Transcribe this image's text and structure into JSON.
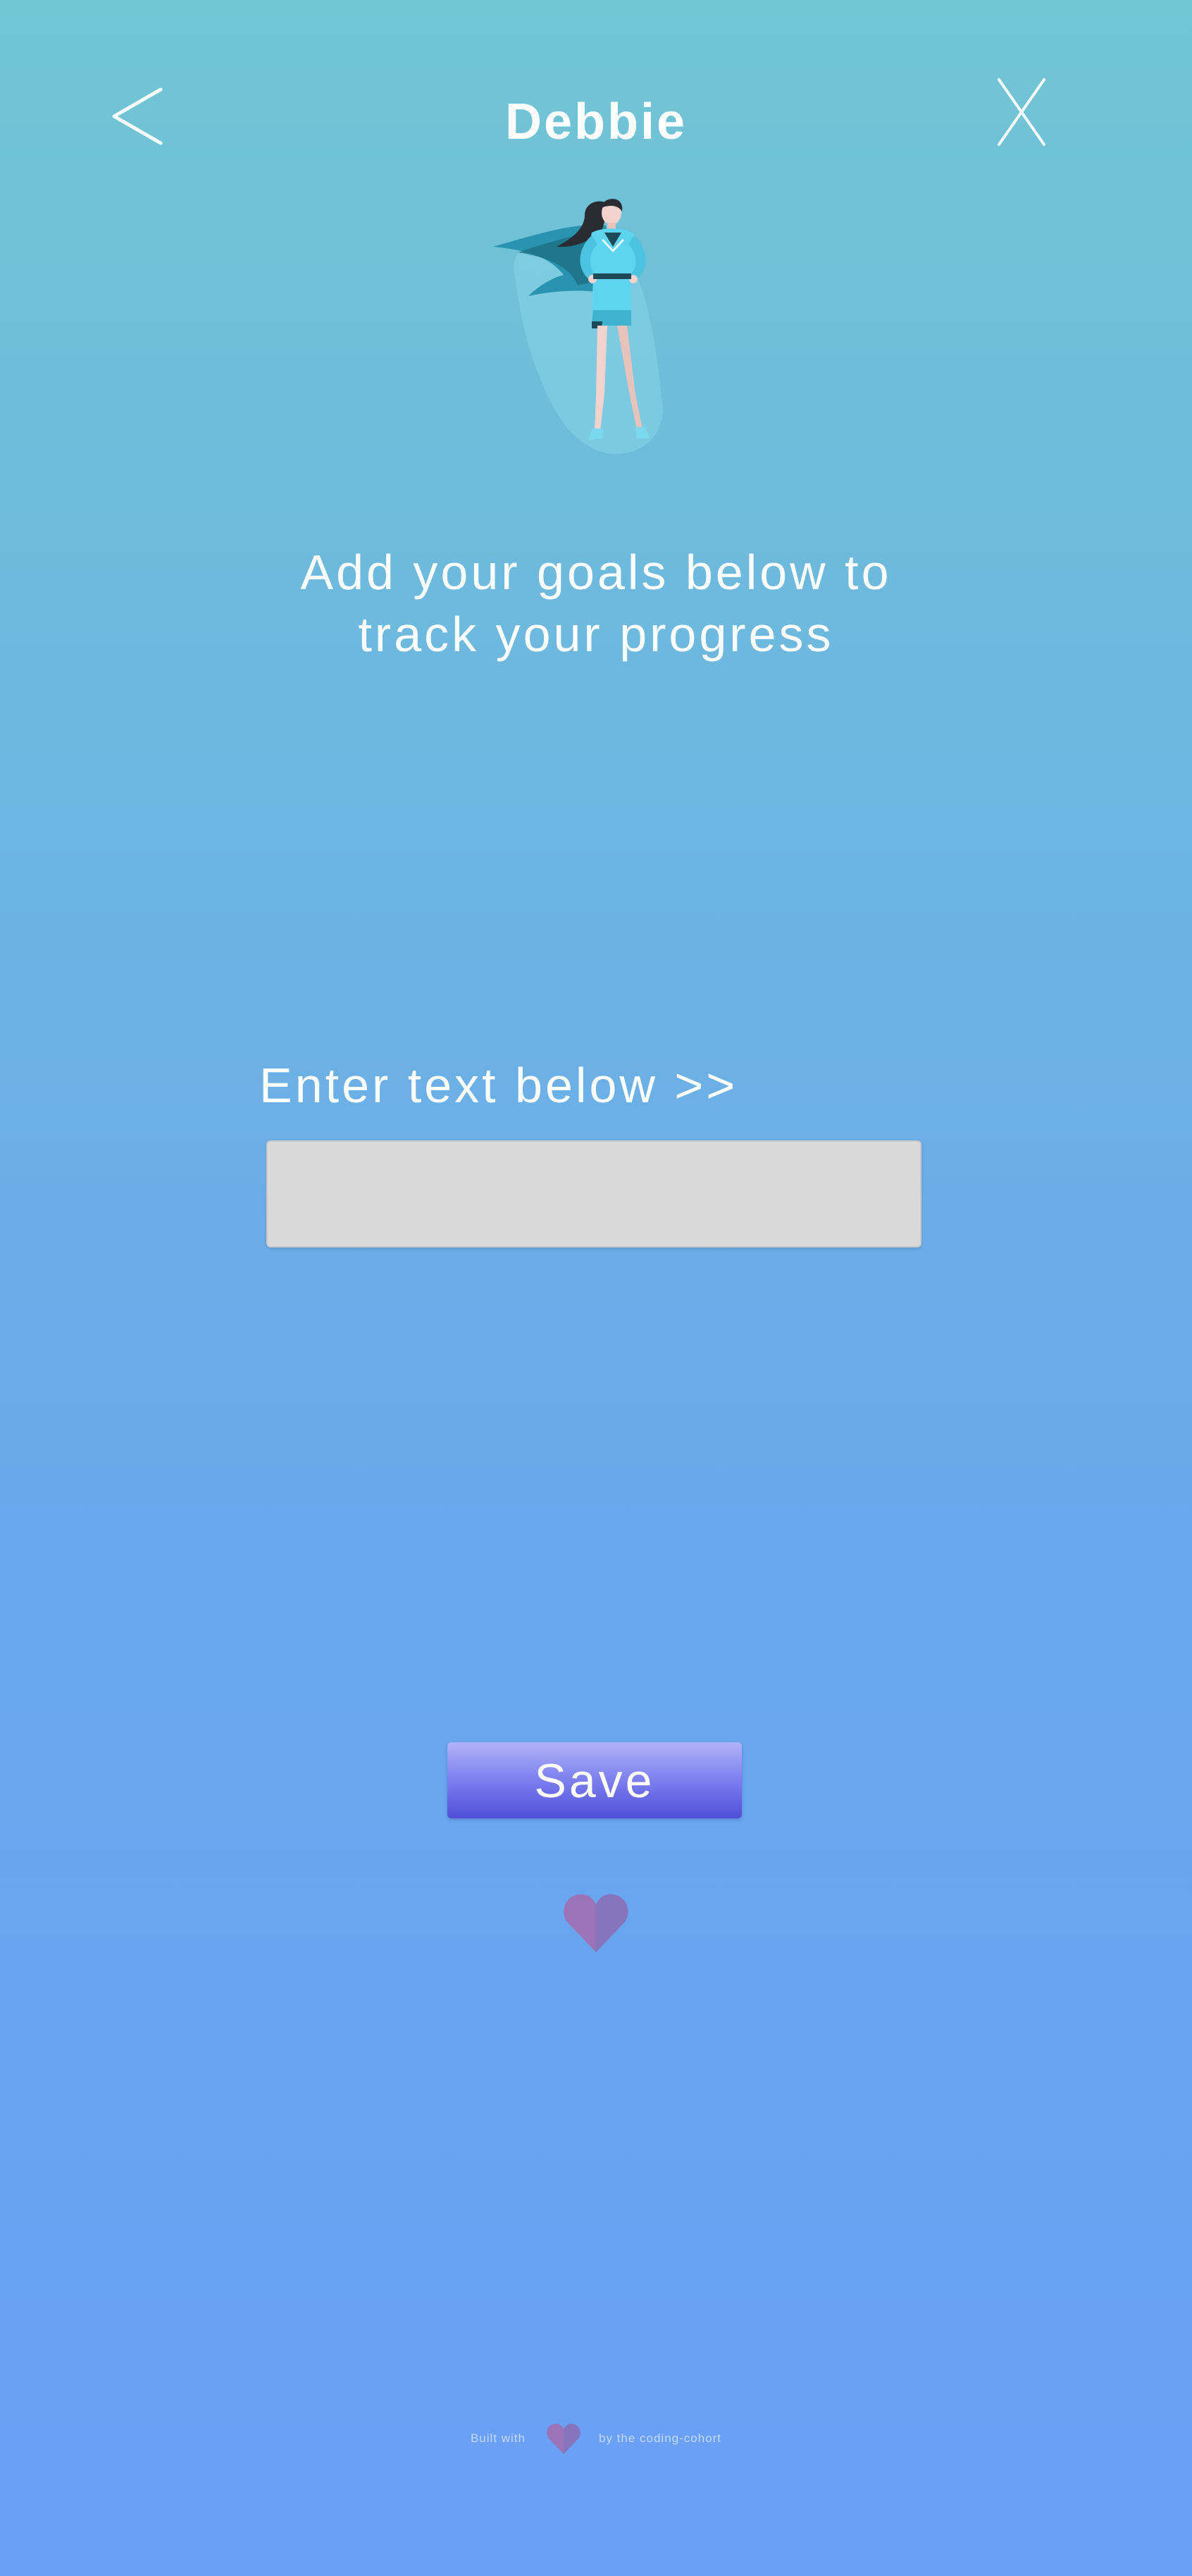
{
  "header": {
    "title": "Debbie",
    "back_icon": "chevron-left-icon",
    "close_icon": "close-x-icon"
  },
  "hero": {
    "illustration": "superhero-woman-illustration"
  },
  "main": {
    "subtitle_line1": "Add your goals below to",
    "subtitle_line2": "track your progress",
    "input_label": "Enter text below >>",
    "input_value": "",
    "input_placeholder": ""
  },
  "actions": {
    "save_label": "Save"
  },
  "decoration": {
    "heart_icon": "heart-icon"
  },
  "footer": {
    "built_with": "Built with",
    "by_text": "by the coding-cohort"
  },
  "colors": {
    "background_top": "#70c6d3",
    "background_bottom": "#6a9ff6",
    "button_top": "#b1b3f8",
    "button_bottom": "#4f4fd8",
    "heart": "#9a70b8",
    "input_bg": "#d9d9d9",
    "hero_suit": "#5fd4ee"
  }
}
